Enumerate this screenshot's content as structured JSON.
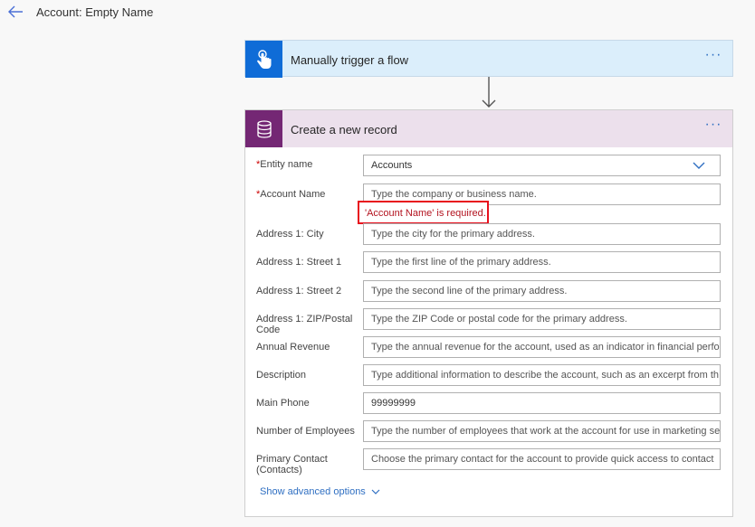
{
  "header": {
    "title": "Account: Empty Name",
    "back_icon": "arrow-left-icon"
  },
  "trigger": {
    "title": "Manually trigger a flow",
    "icon": "hand-tap-icon",
    "more_label": "···"
  },
  "record": {
    "title": "Create a new record",
    "icon": "database-icon",
    "more_label": "···",
    "fields": [
      {
        "label": "Entity name",
        "required": true,
        "value": "Accounts",
        "type": "select"
      },
      {
        "label": "Account Name",
        "required": true,
        "placeholder": "Type the company or business name.",
        "error": "'Account Name' is required."
      },
      {
        "label": "Address 1: City",
        "placeholder": "Type the city for the primary address."
      },
      {
        "label": "Address 1: Street 1",
        "placeholder": "Type the first line of the primary address."
      },
      {
        "label": "Address 1: Street 2",
        "placeholder": "Type the second line of the primary address."
      },
      {
        "label": "Address 1: ZIP/Postal Code",
        "placeholder": "Type the ZIP Code or postal code for the primary address."
      },
      {
        "label": "Annual Revenue",
        "placeholder": "Type the annual revenue for the account, used as an indicator in financial perfo"
      },
      {
        "label": "Description",
        "placeholder": "Type additional information to describe the account, such as an excerpt from th"
      },
      {
        "label": "Main Phone",
        "value": "99999999"
      },
      {
        "label": "Number of Employees",
        "placeholder": "Type the number of employees that work at the account for use in marketing se"
      },
      {
        "label": "Primary Contact (Contacts)",
        "placeholder": "Choose the primary contact for the account to provide quick access to contact"
      }
    ],
    "required_marker": "*",
    "advanced_options_label": "Show advanced options"
  },
  "colors": {
    "trigger_accent": "#0f6cd7",
    "record_accent": "#742774",
    "error": "#e8101d",
    "link": "#2f6fc2"
  }
}
